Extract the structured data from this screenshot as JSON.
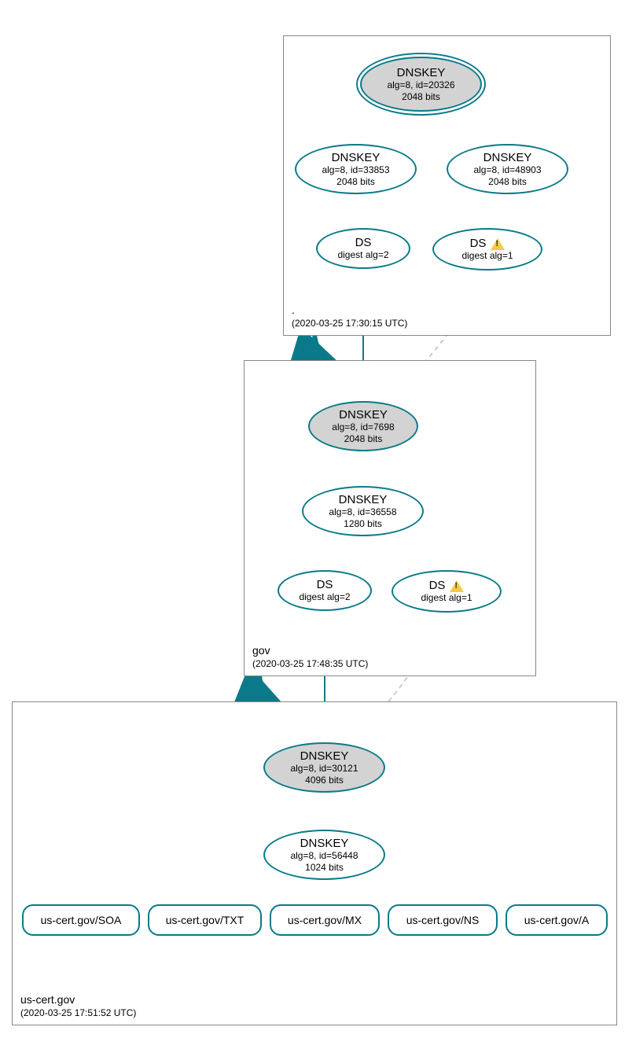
{
  "zones": {
    "root": {
      "name": ".",
      "timestamp": "(2020-03-25 17:30:15 UTC)"
    },
    "gov": {
      "name": "gov",
      "timestamp": "(2020-03-25 17:48:35 UTC)"
    },
    "uscert": {
      "name": "us-cert.gov",
      "timestamp": "(2020-03-25 17:51:52 UTC)"
    }
  },
  "nodes": {
    "root_ksk": {
      "title": "DNSKEY",
      "line1": "alg=8, id=20326",
      "line2": "2048 bits"
    },
    "root_zsk1": {
      "title": "DNSKEY",
      "line1": "alg=8, id=33853",
      "line2": "2048 bits"
    },
    "root_zsk2": {
      "title": "DNSKEY",
      "line1": "alg=8, id=48903",
      "line2": "2048 bits"
    },
    "root_ds1": {
      "title": "DS",
      "line1": "digest alg=2"
    },
    "root_ds2": {
      "title": "DS",
      "line1": "digest alg=1"
    },
    "gov_ksk": {
      "title": "DNSKEY",
      "line1": "alg=8, id=7698",
      "line2": "2048 bits"
    },
    "gov_zsk": {
      "title": "DNSKEY",
      "line1": "alg=8, id=36558",
      "line2": "1280 bits"
    },
    "gov_ds1": {
      "title": "DS",
      "line1": "digest alg=2"
    },
    "gov_ds2": {
      "title": "DS",
      "line1": "digest alg=1"
    },
    "us_ksk": {
      "title": "DNSKEY",
      "line1": "alg=8, id=30121",
      "line2": "4096 bits"
    },
    "us_zsk": {
      "title": "DNSKEY",
      "line1": "alg=8, id=56448",
      "line2": "1024 bits"
    },
    "rr_soa": {
      "title": "us-cert.gov/SOA"
    },
    "rr_txt": {
      "title": "us-cert.gov/TXT"
    },
    "rr_mx": {
      "title": "us-cert.gov/MX"
    },
    "rr_ns": {
      "title": "us-cert.gov/NS"
    },
    "rr_a": {
      "title": "us-cert.gov/A"
    }
  }
}
